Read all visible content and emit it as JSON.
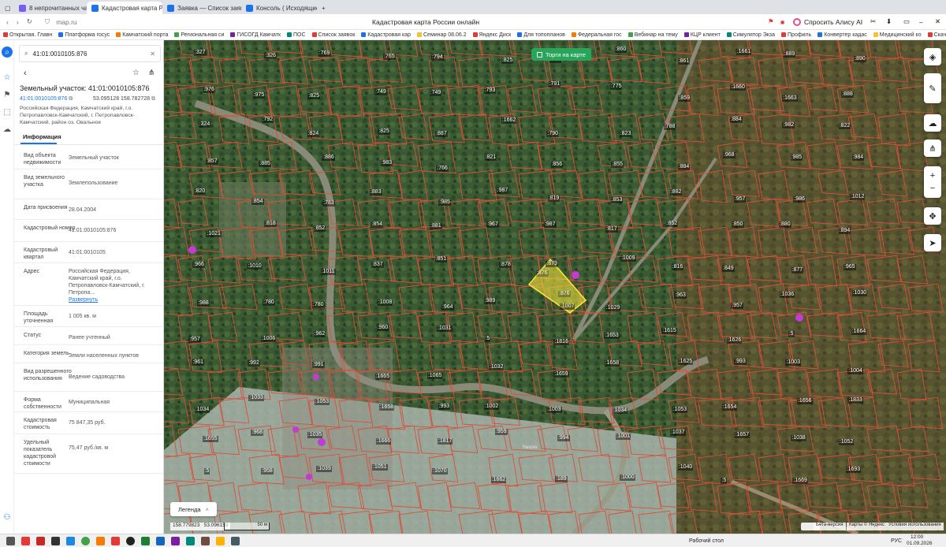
{
  "browser": {
    "tabs": [
      {
        "label": "8 непрочитанных чатов",
        "color": "#7b5cf0",
        "active": false
      },
      {
        "label": "Кадастровая карта Ро",
        "color": "#1a73e8",
        "active": true
      },
      {
        "label": "Заявка — Список заявок",
        "color": "#1a73e8",
        "active": false
      },
      {
        "label": "Консоль ( Исходящие )",
        "color": "#1a73e8",
        "active": false
      }
    ],
    "url": "map.ru",
    "page_title": "Кадастровая карта России онлайн",
    "alice_label": "Спросить Алису AI",
    "bookmarks": [
      "Открытая. Главн",
      "Платформа госус",
      "Камчатский порта",
      "Региональная си",
      "ГИСОГД Камчатк",
      "ПОС",
      "Список заявок",
      "Кадастровая кар",
      "Семинар 08.06.2",
      "Яндекс Диск",
      "Для топопланов",
      "Федеральная гос",
      "Вебинар на тему",
      "КЦР клиент",
      "Симулятор Экза",
      "Профиль",
      "Конвертер кадас",
      "Медицинский ко",
      "Скачать СОГ"
    ]
  },
  "panel": {
    "search_value": "41:01:0010105:876",
    "title": "Земельный участок: 41:01:0010105:876",
    "cad_link": "41:01:0010105:876",
    "coords": "53.095128 158.782728",
    "address_header": "Российская Федерация, Камчатский край, г.о. Петропавловск-Камчатский, г. Петропавловск-Камчатский, район оз. Овальное",
    "info_tab": "Информация",
    "rows": [
      {
        "k": "Вид объекта недвижимости",
        "v": "Земельный участок"
      },
      {
        "k": "Вид земельного участка",
        "v": "Землепользование"
      },
      {
        "k": "Дата присвоения",
        "v": "28.04.2004"
      },
      {
        "k": "Кадастровый номер",
        "v": "41:01:0010105:876"
      },
      {
        "k": "Кадастровый квартал",
        "v": "41:01:0010105"
      },
      {
        "k": "Адрес",
        "v": "Российская Федерация, Камчатский край, г.о. Петропавловск-Камчатский, г. Петропа..."
      },
      {
        "k": "Площадь уточненная",
        "v": "1 005 кв. м"
      },
      {
        "k": "Статус",
        "v": "Ранее учтенный"
      },
      {
        "k": "Категория земель",
        "v": "Земли населенных пунктов"
      },
      {
        "k": "Вид разрешенного использования",
        "v": "Ведение садоводства"
      },
      {
        "k": "Форма собственности",
        "v": "Муниципальная"
      },
      {
        "k": "Кадастровая стоимость",
        "v": "75 847,35 руб."
      },
      {
        "k": "Удельный показатель кадастровой стоимости",
        "v": "75,47 руб./кв. м"
      }
    ],
    "expand_label": "Развернуть"
  },
  "map": {
    "auction_btn": "Торги на карте",
    "legend": "Легенда",
    "coords_readout": "158.779823   53.096159",
    "scale": "50 м",
    "beta": "Бета-версия",
    "copyright": "Карты © Яндекс   Условия использования",
    "yandex_wm": "Yandex",
    "selected": [
      ":876",
      ":876"
    ],
    "parcel_labels": [
      ":327",
      ":326",
      ":769",
      ":765",
      ":794",
      ":825",
      ":826",
      ":860",
      ":861",
      ":1661",
      ":889",
      ":890",
      ":976",
      ":975",
      ":825",
      ":749",
      ":749",
      ":793",
      ":791",
      ":775",
      ":859",
      ":1660",
      ":1663",
      ":888",
      ":324",
      ":792",
      ":824",
      ":825",
      ":887",
      ":1662",
      ":790",
      ":823",
      ":788",
      ":884",
      ":982",
      ":822",
      ":857",
      ":885",
      ":886",
      ":983",
      ":766",
      ":821",
      ":856",
      ":855",
      ":884",
      ":968",
      ":985",
      ":984",
      ":820",
      ":854",
      ":783",
      ":883",
      ":985",
      ":987",
      ":819",
      ":853",
      ":882",
      ":957",
      ":986",
      ":1012",
      ":1021",
      ":818",
      ":852",
      ":854",
      ":881",
      ":967",
      ":987",
      ":817",
      ":852",
      ":850",
      ":880",
      ":894",
      ":966",
      ":1010",
      ":1011",
      ":837",
      ":851",
      ":878",
      ":879",
      ":1009",
      ":816",
      ":849",
      ":877",
      ":965",
      ":988",
      ":780",
      ":780",
      ":1008",
      ":964",
      ":989",
      ":1007",
      ":1029",
      ":963",
      ":957",
      ":1036",
      ":1030",
      ":957",
      ":1006",
      ":962",
      ":960",
      ":1031",
      ":5",
      ":1816",
      ":1653",
      ":1615",
      ":1626",
      ":5",
      ":1664",
      ":961",
      ":992",
      ":991",
      ":1665",
      ":1065",
      ":1032",
      ":1659",
      ":1658",
      ":1625",
      ":993",
      ":1003",
      ":1004",
      ":1034",
      ":1033",
      ":1053",
      ":1658",
      ":993",
      ":1002",
      ":1003",
      ":1034",
      ":1053",
      ":1654",
      ":1656",
      ":1833",
      ":1655",
      ":968",
      ":1035",
      ":1666",
      ":1817",
      ":959",
      ":994",
      ":1001",
      ":1037",
      ":1657",
      ":1038",
      ":1052",
      ":5",
      ":958",
      ":1039",
      ":1051",
      ":1070",
      ":1662",
      ":189",
      ":1000",
      ":1040",
      ":5",
      ":1669",
      ":1693",
      ":5"
    ]
  },
  "taskbar": {
    "desktop_label": "Рабочий стол",
    "lang": "РУС",
    "time": "12:00",
    "date": "01.09.2026"
  }
}
